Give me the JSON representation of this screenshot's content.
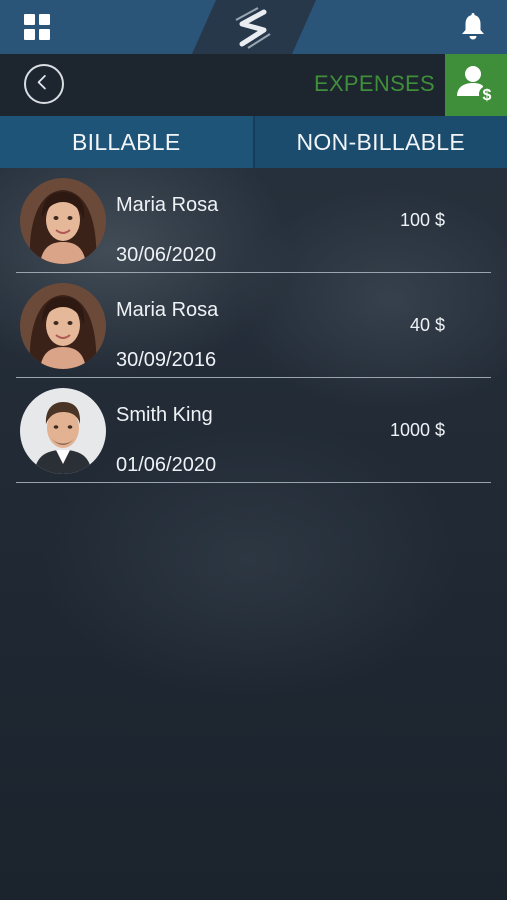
{
  "header": {
    "menu_icon": "grid-icon",
    "logo_icon": "app-logo",
    "notification_icon": "bell-icon"
  },
  "subheader": {
    "back_icon": "chevron-left-icon",
    "section_label": "EXPENSES",
    "section_icon": "user-dollar-icon",
    "accent_color": "#3f8f3a"
  },
  "tabs": [
    {
      "label": "BILLABLE"
    },
    {
      "label": "NON-BILLABLE"
    }
  ],
  "expenses": [
    {
      "name": "Maria Rosa",
      "date": "30/06/2020",
      "amount": "100 $",
      "avatar": "woman-avatar"
    },
    {
      "name": "Maria Rosa",
      "date": "30/09/2016",
      "amount": "40 $",
      "avatar": "woman-avatar"
    },
    {
      "name": "Smith King",
      "date": "01/06/2020",
      "amount": "1000 $",
      "avatar": "man-avatar"
    }
  ],
  "colors": {
    "topbar": "#2b5578",
    "tab": "#1f5479",
    "background": "#1f2833"
  }
}
